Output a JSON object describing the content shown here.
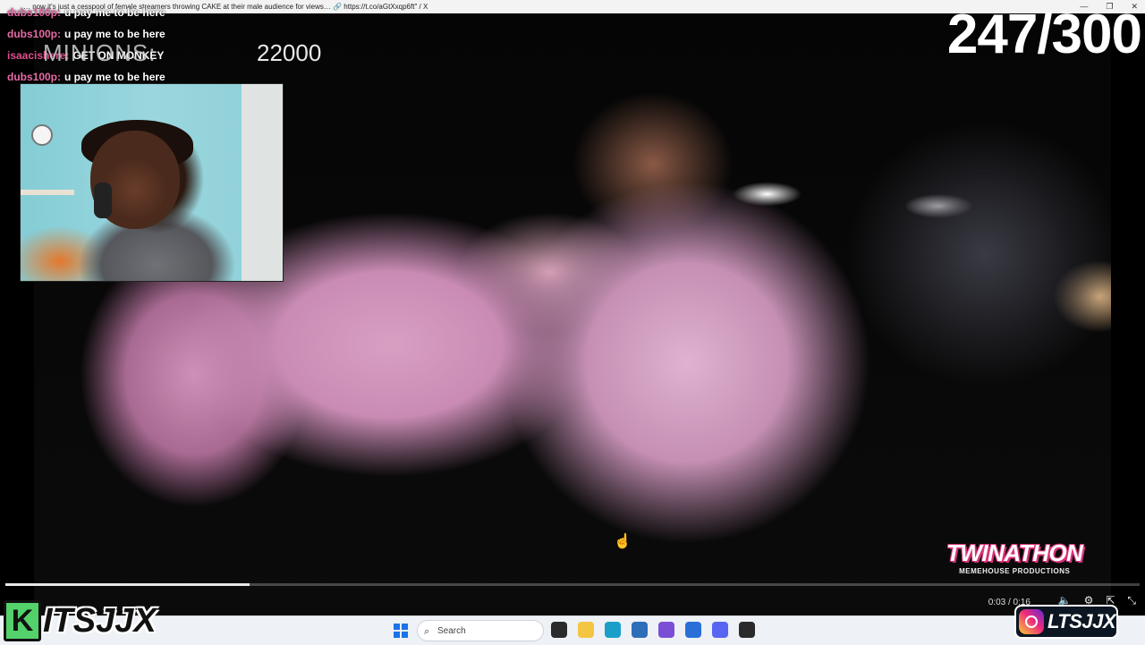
{
  "window": {
    "title": "… now it's just a cesspool of female streamers throwing CAKE at their male audience for views… 🔗 https://t.co/aGtXxqp6ft\" / X",
    "controls": [
      "—",
      "❐",
      "✕"
    ]
  },
  "chat": [
    {
      "user": "dubs100p:",
      "text": "u pay me to be here"
    },
    {
      "user": "dubs100p:",
      "text": "u pay me to be here"
    },
    {
      "user": "isaacishere:",
      "text": "GET ON MONKEY"
    },
    {
      "user": "dubs100p:",
      "text": "u pay me to be here"
    }
  ],
  "overlay": {
    "minions_label": "MINIONS:",
    "minions_count": "22000",
    "counter": "247/300"
  },
  "video": {
    "progress": 0.215,
    "time": "0:03 / 0:16",
    "watermark_title": "TWINATHON",
    "watermark_sub": "MEMEHOUSE PRODUCTIONS"
  },
  "taskbar": {
    "search_placeholder": "Search",
    "apps": [
      {
        "name": "task-view-icon",
        "color": "#2b2b2b"
      },
      {
        "name": "file-explorer-icon",
        "color": "#f4c542"
      },
      {
        "name": "edge-icon",
        "color": "#1aa0c8"
      },
      {
        "name": "settings-icon",
        "color": "#2c6fb8"
      },
      {
        "name": "photos-icon",
        "color": "#7a4fd6"
      },
      {
        "name": "store-icon",
        "color": "#2a6fd8"
      },
      {
        "name": "discord-icon",
        "color": "#5865f2"
      },
      {
        "name": "obs-icon",
        "color": "#2a2a2a"
      }
    ]
  },
  "branding": {
    "left_initial": "K",
    "left_name": "ITSJJX",
    "right_name": "LTSJJX"
  }
}
